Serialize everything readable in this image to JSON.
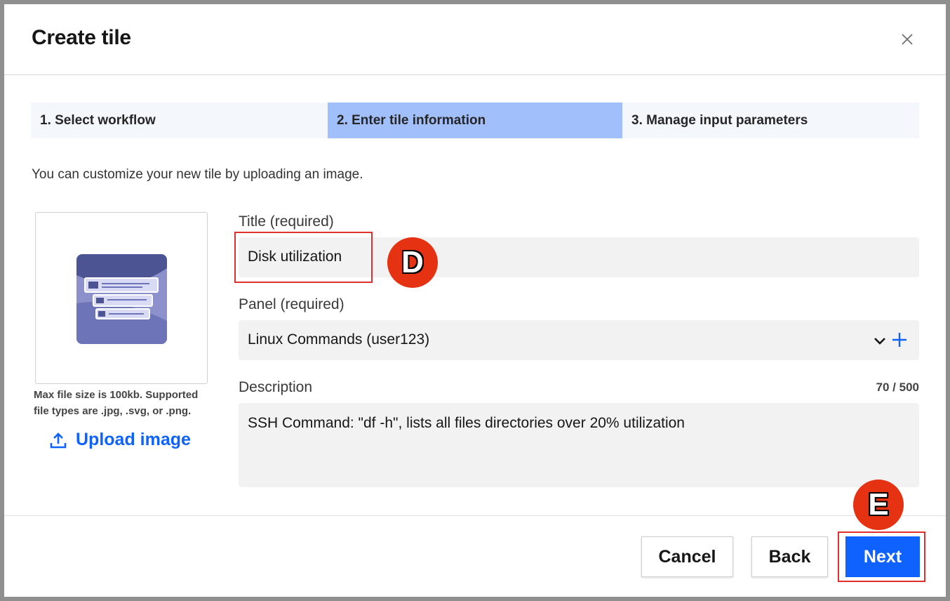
{
  "dialog": {
    "title": "Create tile"
  },
  "steps": [
    {
      "label": "1. Select workflow"
    },
    {
      "label": "2. Enter tile information"
    },
    {
      "label": "3. Manage input parameters"
    }
  ],
  "active_step": 2,
  "intro": "You can customize your new tile by uploading an image.",
  "image": {
    "hint": "Max file size is 100kb. Supported file types are .jpg, .svg, or .png.",
    "upload_label": "Upload image"
  },
  "form": {
    "title_label": "Title (required)",
    "title_value": "Disk utilization",
    "panel_label": "Panel (required)",
    "panel_value": "Linux Commands (user123)",
    "description_label": "Description",
    "description_counter": "70 / 500",
    "description_value": "SSH Command: \"df -h\", lists all files directories over 20% utilization"
  },
  "footer": {
    "cancel": "Cancel",
    "back": "Back",
    "next": "Next"
  },
  "annotations": {
    "marker_d": "D",
    "marker_e": "E"
  },
  "colors": {
    "primary": "#0f62fe",
    "active_step": "#a1c0fb",
    "marker": "#e53212",
    "highlight": "#e02f2f"
  },
  "icons": [
    "close-icon",
    "upload-icon",
    "chevron-down-icon",
    "plus-icon",
    "tile-thumbnail"
  ]
}
